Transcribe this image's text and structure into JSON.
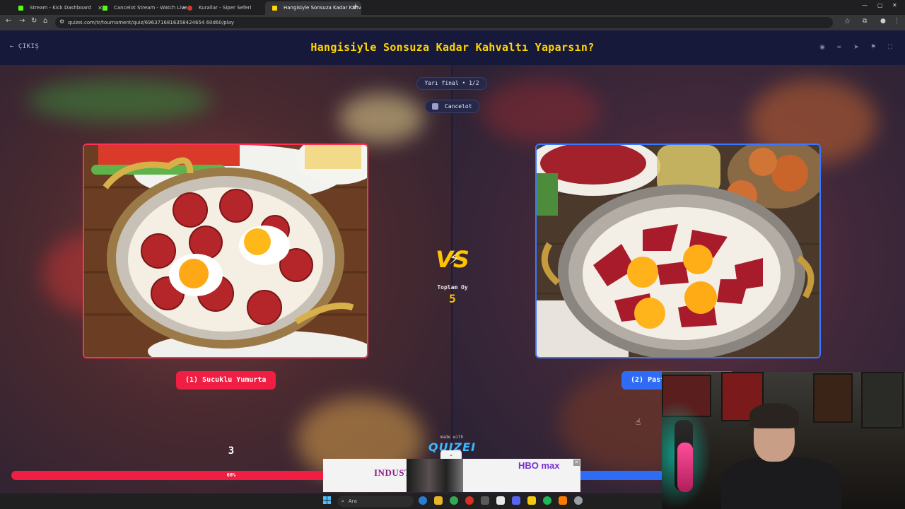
{
  "browser": {
    "tabs": [
      {
        "label": "Stream - Kick Dashboard",
        "favicon_color": "#53fc18"
      },
      {
        "label": "Cancelot Stream - Watch Live o",
        "favicon_color": "#53fc18"
      },
      {
        "label": "Kurallar - Siper Seferi",
        "favicon_color": "#d23a2a"
      },
      {
        "label": "Hangisiyle Sonsuza Kadar Kahvı",
        "favicon_color": "#ffd600"
      }
    ],
    "url": "quizei.com/tr/tournament/quiz/6963716816358424654 60d60/play"
  },
  "header": {
    "exit_label": "ÇIKIŞ",
    "title": "Hangisiyle Sonsuza Kadar Kahvaltı Yaparsın?",
    "icons": [
      "eye-icon",
      "link-icon",
      "send-icon",
      "flag-icon",
      "fullscreen-icon"
    ]
  },
  "round": {
    "stage_label": "Yarı final • 1/2",
    "creator_name": "Cancelot"
  },
  "options": {
    "left": {
      "label": "(1) Sucuklu Yumurta",
      "votes": "3",
      "percent_label": "60%",
      "percent": 60,
      "color": "#f01e43"
    },
    "right": {
      "label": "(2) Pastırmalı Yumurta",
      "color": "#2f6cf5"
    }
  },
  "center": {
    "vs_label": "VS",
    "total_label": "Toplam Oy",
    "total_value": "5"
  },
  "footer": {
    "made_with": "made with",
    "brand": "QUIZEI"
  },
  "ad": {
    "headline": "INDUSTRY",
    "brand": "HBO max",
    "chevron": "⌄"
  },
  "taskbar": {
    "search_placeholder": "Ara"
  }
}
